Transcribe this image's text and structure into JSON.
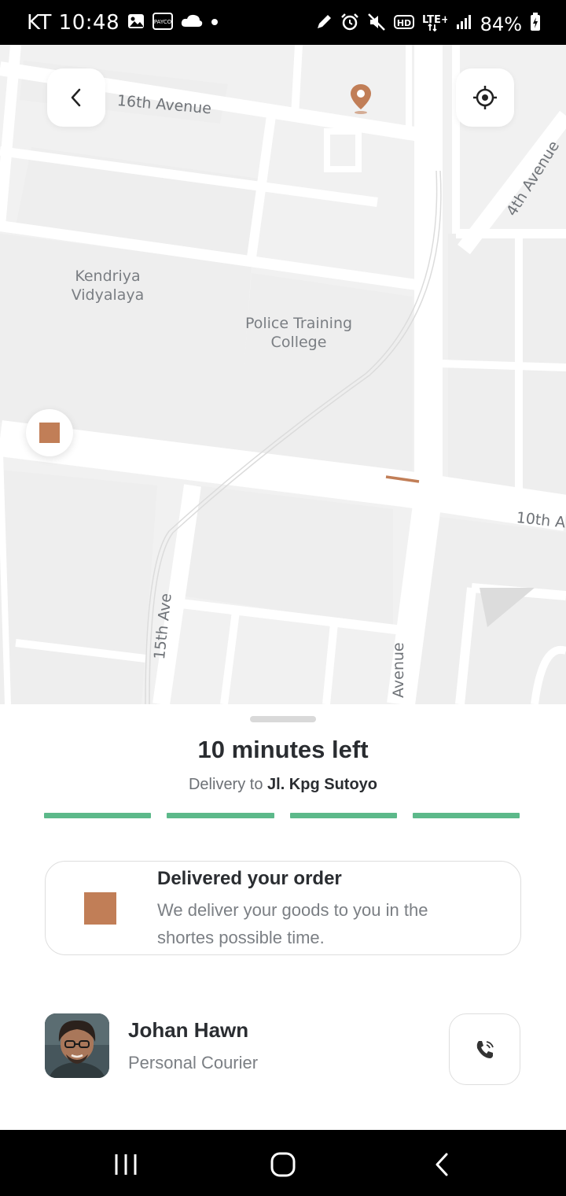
{
  "status_bar": {
    "time": "KT 10:48",
    "battery": "84%",
    "left_icons": [
      "gallery-icon",
      "payco-icon",
      "cloud-icon",
      "dot-icon"
    ],
    "right_icons": [
      "pen-icon",
      "alarm-icon",
      "mute-icon",
      "hd-icon",
      "lte-icon",
      "signal-icon",
      "battery-icon"
    ]
  },
  "map": {
    "streets": {
      "sixteenth_avenue": "16th Avenue",
      "fourth_avenue": "4th Avenue",
      "tenth_avenue": "10th A",
      "fifteenth_ave": "15th Ave",
      "avenue_bottom": "Avenue"
    },
    "places": {
      "kendriya": "Kendriya\nVidyalaya",
      "police": "Police Training\nCollege"
    },
    "colors": {
      "accent": "#c17e57",
      "route": "#c17e57",
      "road": "#ffffff",
      "land": "#f1f1f1"
    }
  },
  "sheet": {
    "eta_title": "10 minutes left",
    "delivery_prefix": "Delivery to ",
    "delivery_address": "Jl. Kpg Sutoyo",
    "progress_fraction": 1.0,
    "progress_segments": 4,
    "progress_color": "#5cb98a",
    "info": {
      "title": "Delivered your order",
      "description": "We deliver your goods to you in the shortes possible time."
    },
    "courier": {
      "name": "Johan Hawn",
      "role": "Personal Courier"
    }
  }
}
